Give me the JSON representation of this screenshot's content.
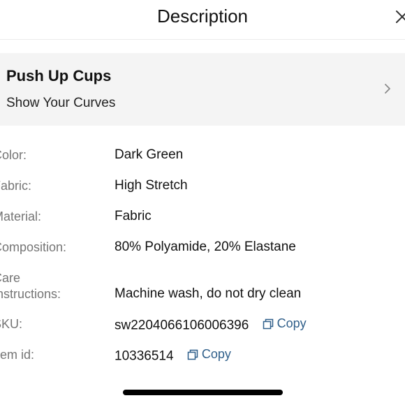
{
  "header": {
    "title": "Description"
  },
  "banner": {
    "title": "Push Up Cups",
    "subtitle": "Show Your Curves"
  },
  "attributes": [
    {
      "label": "Color:",
      "value": "Dark Green"
    },
    {
      "label": "Fabric:",
      "value": "High Stretch"
    },
    {
      "label": "Material:",
      "value": "Fabric"
    },
    {
      "label": "Composition:",
      "value": "80% Polyamide, 20% Elastane"
    },
    {
      "label": "Care\nInstructions:",
      "value": "Machine wash, do not dry clean"
    },
    {
      "label": "SKU:",
      "value": "sw2204066106006396",
      "copy_label": "Copy"
    },
    {
      "label": "Item id:",
      "value": "10336514",
      "copy_label": "Copy"
    }
  ],
  "colors": {
    "link": "#2f5f8a",
    "label": "#757575",
    "banner_bg": "#f4f4f4"
  }
}
